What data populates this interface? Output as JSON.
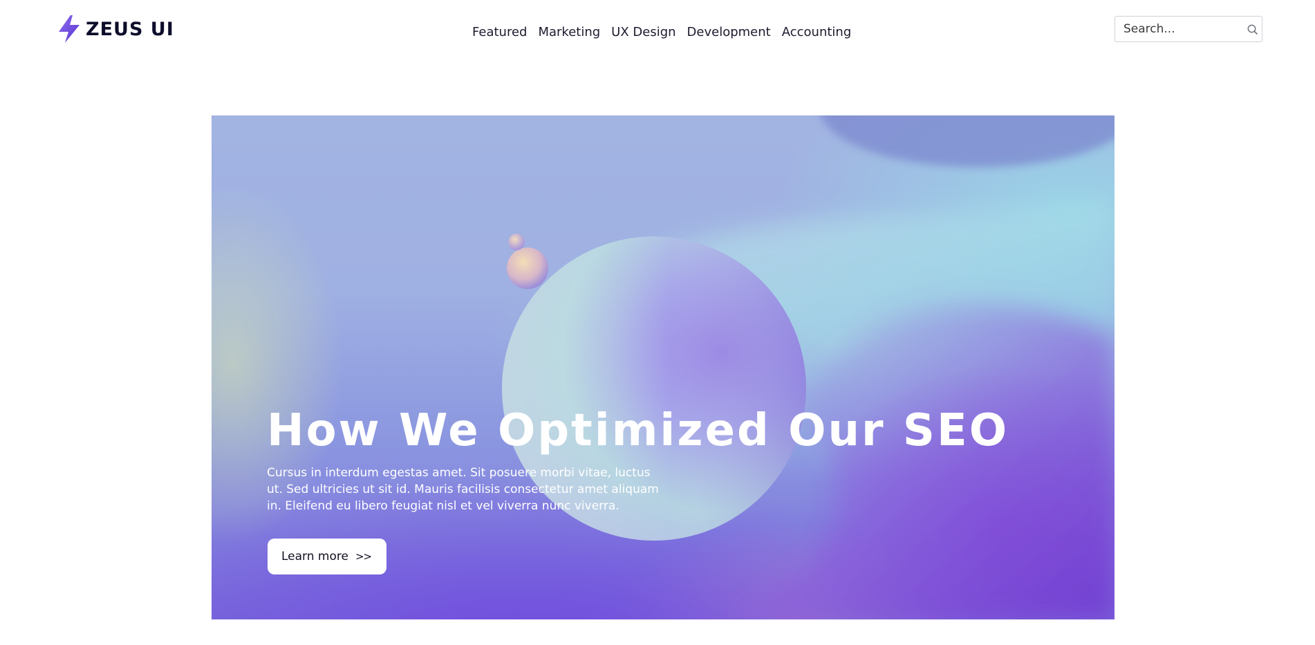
{
  "header": {
    "logo": {
      "text": "ZEUS UI",
      "icon": "lightning-bolt-icon",
      "color": "#6c4be0"
    },
    "nav": [
      {
        "label": "Featured"
      },
      {
        "label": "Marketing"
      },
      {
        "label": "UX Design"
      },
      {
        "label": "Development"
      },
      {
        "label": "Accounting"
      }
    ],
    "search": {
      "placeholder": "Search...",
      "value": "",
      "icon": "search-icon"
    }
  },
  "hero": {
    "title": "How We Optimized Our SEO",
    "description": "Cursus in interdum egestas amet. Sit posuere morbi vitae, luctus ut. Sed ultricies ut sit id. Mauris facilisis consectetur amet aliquam in. Eleifend eu libero feugiat nisl et vel viverra nunc viverra.",
    "cta": {
      "label": "Learn more",
      "icon": ">>"
    },
    "colors": {
      "top": "#a2b4e2",
      "bottom": "#7a6cdb",
      "accent_purple": "#843cd7",
      "accent_teal": "#96e1e8"
    }
  }
}
